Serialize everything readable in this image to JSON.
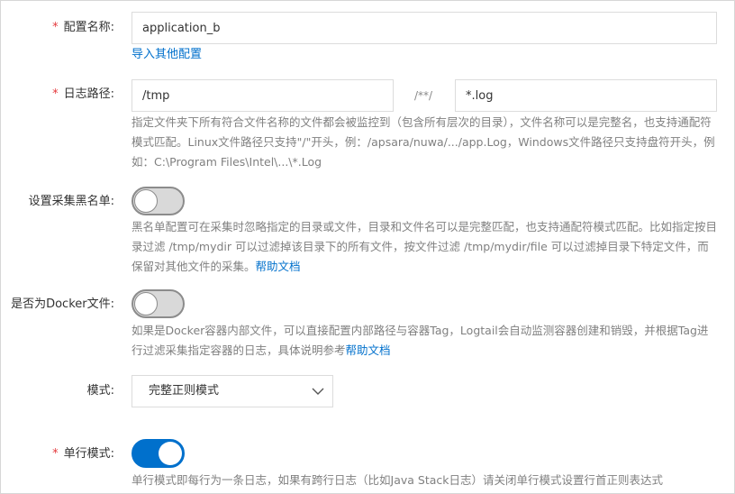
{
  "config_name": {
    "label": "配置名称:",
    "value": "application_b",
    "import_link": "导入其他配置"
  },
  "log_path": {
    "label": "日志路径:",
    "dir_value": "/tmp",
    "separator": "/**/",
    "file_value": "*.log",
    "help_text": "指定文件夹下所有符合文件名称的文件都会被监控到（包含所有层次的目录），文件名称可以是完整名，也支持通配符模式匹配。Linux文件路径只支持\"/\"开头，例：/apsara/nuwa/.../app.Log，Windows文件路径只支持盘符开头，例如：C:\\Program Files\\Intel\\...\\*.Log"
  },
  "blacklist": {
    "label": "设置采集黑名单:",
    "enabled": false,
    "help_text": "黑名单配置可在采集时忽略指定的目录或文件，目录和文件名可以是完整匹配，也支持通配符模式匹配。比如指定按目录过滤 /tmp/mydir 可以过滤掉该目录下的所有文件，按文件过滤 /tmp/mydir/file 可以过滤掉目录下特定文件，而保留对其他文件的采集。",
    "help_link": "帮助文档"
  },
  "docker": {
    "label": "是否为Docker文件:",
    "enabled": false,
    "help_text": "如果是Docker容器内部文件，可以直接配置内部路径与容器Tag，Logtail会自动监测容器创建和销毁，并根据Tag进行过滤采集指定容器的日志，具体说明参考",
    "help_link": "帮助文档"
  },
  "mode": {
    "label": "模式:",
    "selected": "完整正则模式"
  },
  "single_line": {
    "label": "单行模式:",
    "enabled": true,
    "help_text": "单行模式即每行为一条日志，如果有跨行日志（比如Java Stack日志）请关闭单行模式设置行首正则表达式"
  },
  "colors": {
    "required": "#e4393c",
    "link": "#0070cc",
    "toggle_on": "#0070cc",
    "toggle_off": "#d9d9d9"
  }
}
